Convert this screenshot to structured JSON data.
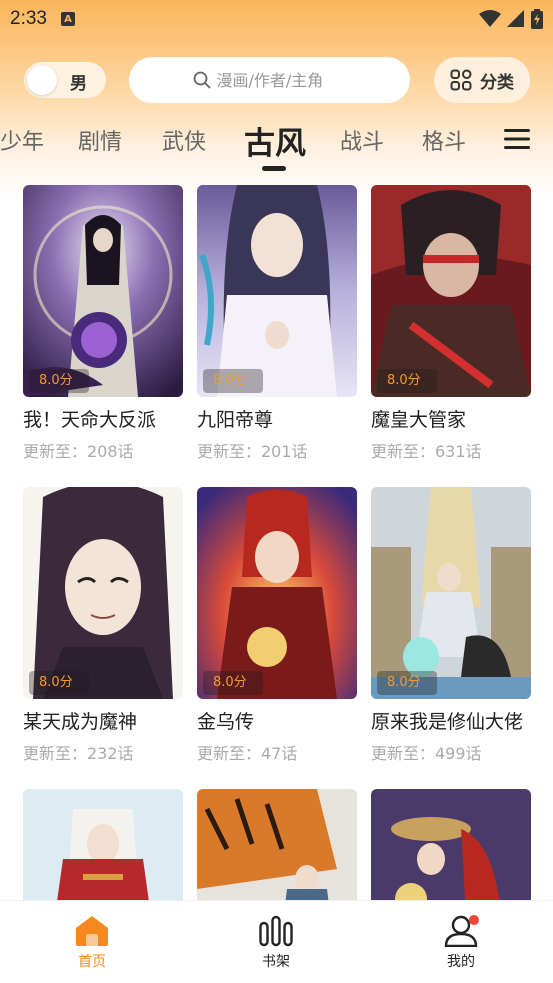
{
  "status_bar": {
    "time": "2:33"
  },
  "header": {
    "gender_label": "男",
    "search_placeholder": "漫画/作者/主角",
    "category_label": "分类"
  },
  "tabs": [
    {
      "label": "少年"
    },
    {
      "label": "剧情"
    },
    {
      "label": "武侠"
    },
    {
      "label": "古风",
      "active": true
    },
    {
      "label": "战斗"
    },
    {
      "label": "格斗"
    }
  ],
  "comics": [
    {
      "title": "我！天命大反派",
      "update": "更新至：208话",
      "score": "8.0分"
    },
    {
      "title": "九阳帝尊",
      "update": "更新至：201话",
      "score": "8.0分"
    },
    {
      "title": "魔皇大管家",
      "update": "更新至：631话",
      "score": "8.0分"
    },
    {
      "title": "某天成为魔神",
      "update": "更新至：232话",
      "score": "8.0分"
    },
    {
      "title": "金乌传",
      "update": "更新至：47话",
      "score": "8.0分"
    },
    {
      "title": "原来我是修仙大佬",
      "update": "更新至：499话",
      "score": "8.0分"
    }
  ],
  "bottom_nav": [
    {
      "label": "首页",
      "active": true
    },
    {
      "label": "书架"
    },
    {
      "label": "我的"
    }
  ],
  "colors": {
    "accent": "#f5891f",
    "header_gradient_top": "#fbb55a",
    "score_text": "#f39a2e",
    "notification": "#f44336"
  }
}
